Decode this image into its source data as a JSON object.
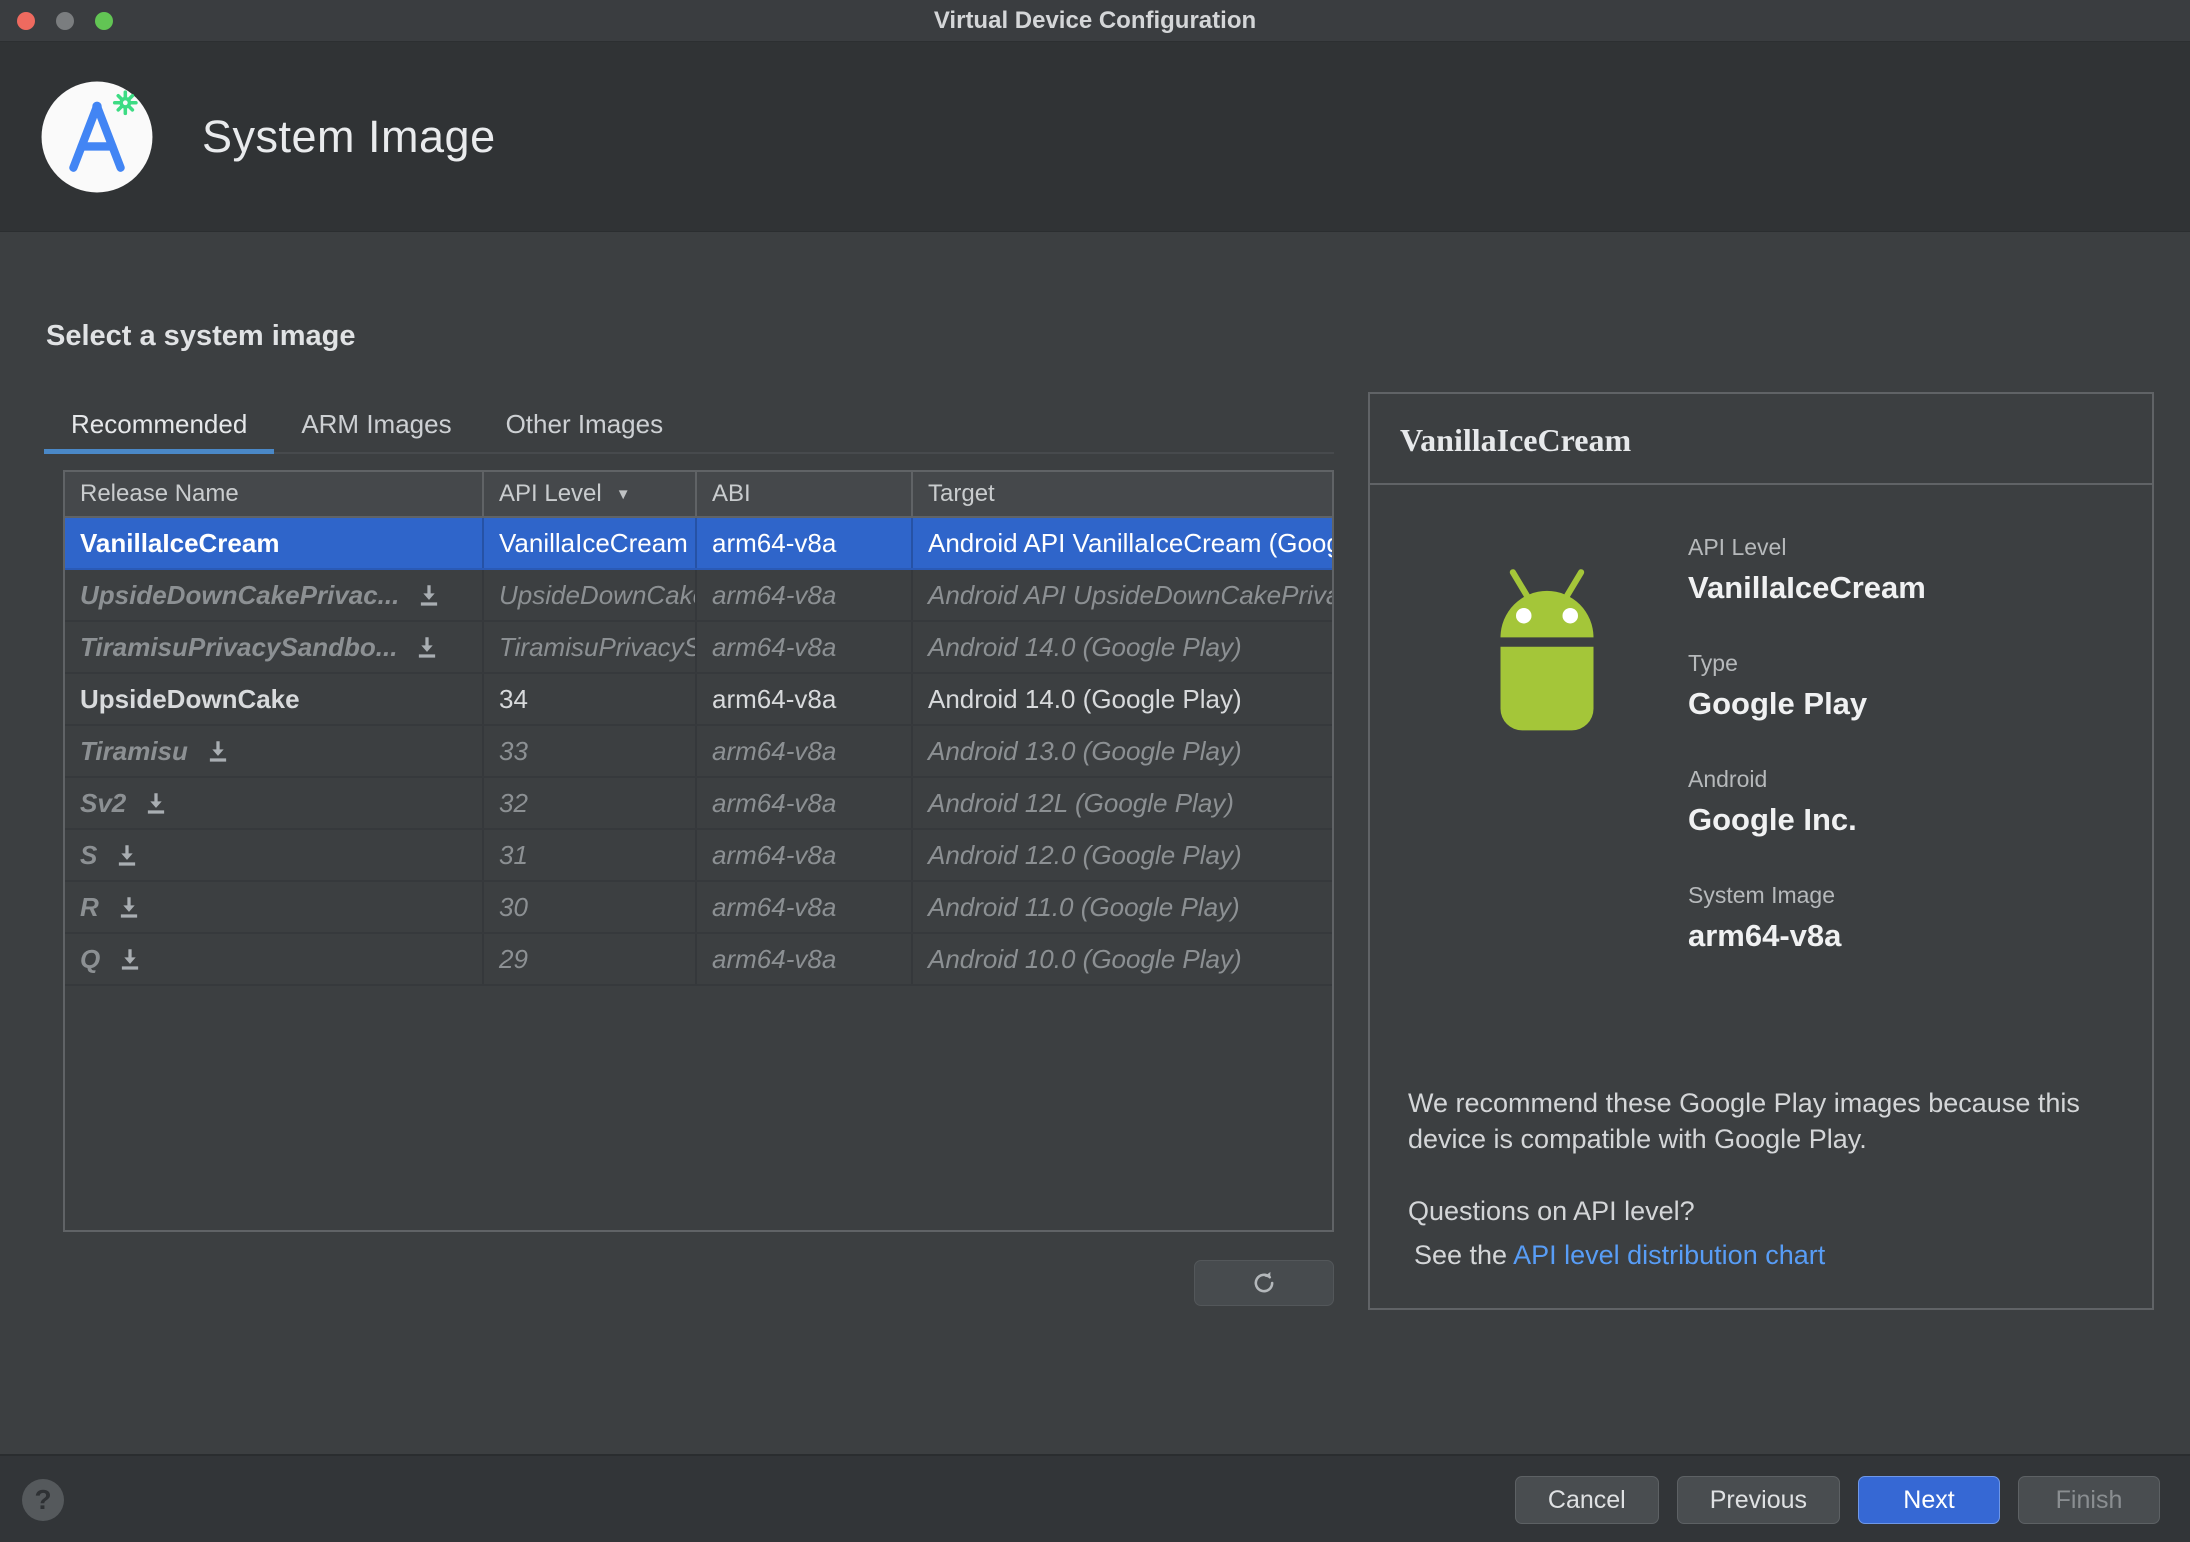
{
  "window": {
    "title": "Virtual Device Configuration"
  },
  "header": {
    "title": "System Image"
  },
  "left": {
    "heading": "Select a system image",
    "tabs": [
      {
        "label": "Recommended",
        "selected": true
      },
      {
        "label": "ARM Images",
        "selected": false
      },
      {
        "label": "Other Images",
        "selected": false
      }
    ]
  },
  "table": {
    "columns": {
      "release": "Release Name",
      "api": "API Level",
      "abi": "ABI",
      "target": "Target"
    },
    "sort": {
      "column": "API Level",
      "direction": "descending"
    },
    "rows": [
      {
        "release": "VanillaIceCream",
        "api": "VanillaIceCream",
        "abi": "arm64-v8a",
        "target": "Android API VanillaIceCream (Google Play)",
        "state": "selected",
        "downloadable": false
      },
      {
        "release": "UpsideDownCakePrivac...",
        "api": "UpsideDownCakePrivacySandbox",
        "abi": "arm64-v8a",
        "target": "Android API UpsideDownCakePrivacySandbox (Google Play)",
        "state": "remote",
        "downloadable": true
      },
      {
        "release": "TiramisuPrivacySandbo...",
        "api": "TiramisuPrivacySandbox",
        "abi": "arm64-v8a",
        "target": "Android 14.0 (Google Play)",
        "state": "remote",
        "downloadable": true
      },
      {
        "release": "UpsideDownCake",
        "api": "34",
        "abi": "arm64-v8a",
        "target": "Android 14.0 (Google Play)",
        "state": "local",
        "downloadable": false
      },
      {
        "release": "Tiramisu",
        "api": "33",
        "abi": "arm64-v8a",
        "target": "Android 13.0 (Google Play)",
        "state": "remote",
        "downloadable": true
      },
      {
        "release": "Sv2",
        "api": "32",
        "abi": "arm64-v8a",
        "target": "Android 12L (Google Play)",
        "state": "remote",
        "downloadable": true
      },
      {
        "release": "S",
        "api": "31",
        "abi": "arm64-v8a",
        "target": "Android 12.0 (Google Play)",
        "state": "remote",
        "downloadable": true
      },
      {
        "release": "R",
        "api": "30",
        "abi": "arm64-v8a",
        "target": "Android 11.0 (Google Play)",
        "state": "remote",
        "downloadable": true
      },
      {
        "release": "Q",
        "api": "29",
        "abi": "arm64-v8a",
        "target": "Android 10.0 (Google Play)",
        "state": "remote",
        "downloadable": true
      }
    ]
  },
  "details": {
    "title": "VanillaIceCream",
    "fields": [
      {
        "label": "API Level",
        "value": "VanillaIceCream"
      },
      {
        "label": "Type",
        "value": "Google Play"
      },
      {
        "label": "Android",
        "value": "Google Inc."
      },
      {
        "label": "System Image",
        "value": "arm64-v8a"
      }
    ],
    "recommendation": "We recommend these Google Play images because this device is compatible with Google Play.",
    "question": "Questions on API level?",
    "see_the": "See the ",
    "link": "API level distribution chart"
  },
  "footer": {
    "cancel": "Cancel",
    "previous": "Previous",
    "next": "Next",
    "finish": "Finish"
  },
  "icons": {
    "sort_descending": "▼",
    "question_mark": "?",
    "download": "tray-arrow-down",
    "refresh": "circular-arrows",
    "android_robot": "android-mascot-green",
    "android_studio_logo": "compass-a-badge"
  },
  "colors": {
    "selection_blue": "#2F65CA",
    "tab_underline": "#4A88C7",
    "link_blue": "#589DF6",
    "android_green": "#A4C639",
    "primary_button": "#3668D4",
    "traffic_close": "#EE6A5F",
    "traffic_minimize": "#7A7D7F",
    "traffic_zoom": "#62C554"
  }
}
